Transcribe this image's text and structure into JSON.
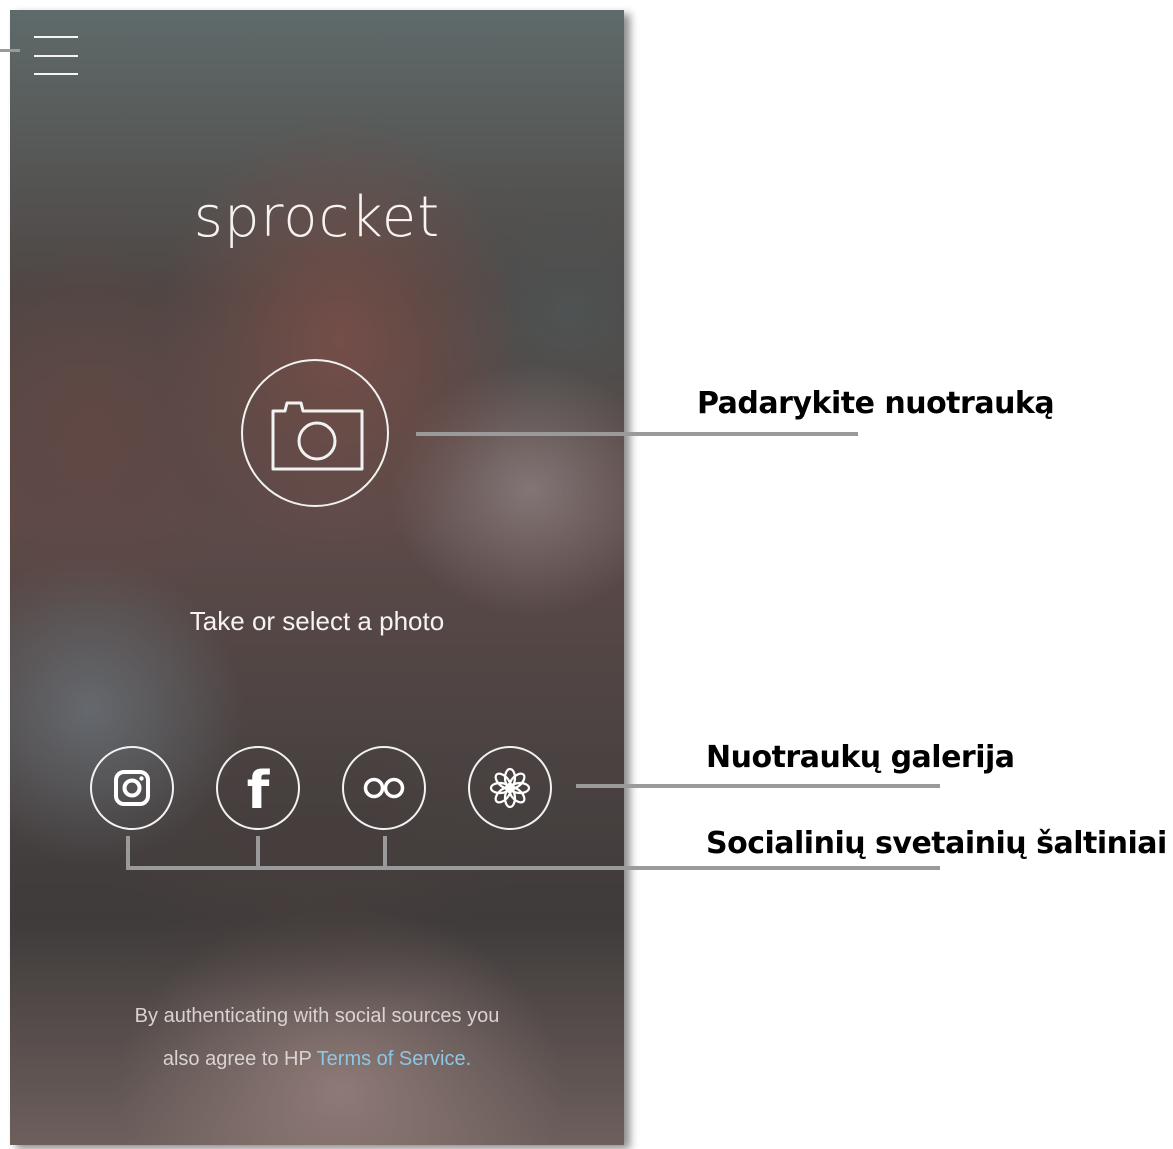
{
  "app": {
    "title": "sprocket",
    "prompt": "Take or select a photo"
  },
  "menu": {
    "icon": "hamburger-menu-icon"
  },
  "camera": {
    "icon": "camera-icon"
  },
  "sources": [
    {
      "name": "instagram",
      "icon": "instagram-icon"
    },
    {
      "name": "facebook",
      "icon": "facebook-icon",
      "glyph": "f"
    },
    {
      "name": "flickr",
      "icon": "flickr-icon"
    },
    {
      "name": "photo-gallery",
      "icon": "flower-icon"
    }
  ],
  "legal": {
    "line1": "By authenticating with social sources you",
    "line2_prefix": "also agree to HP ",
    "terms_link": "Terms of Service."
  },
  "callouts": {
    "take_photo": "Padarykite nuotrauką",
    "gallery": "Nuotraukų galerija",
    "social": "Socialinių svetainių šaltiniai"
  },
  "colors": {
    "link": "#8cc7e6",
    "callout_line": "#9a9a9a"
  }
}
